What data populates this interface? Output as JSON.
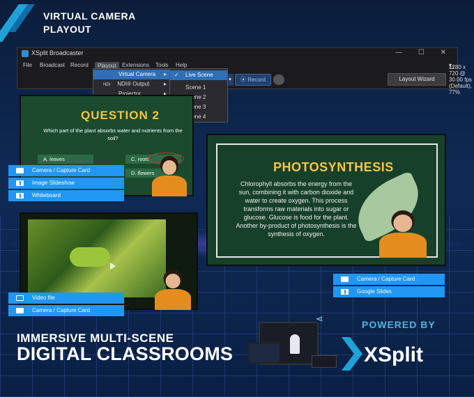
{
  "header": {
    "line1": "VIRTUAL CAMERA",
    "line2": "PLAYOUT"
  },
  "app": {
    "title": "XSplit Broadcaster",
    "window_buttons": "— ☐ ✕",
    "menu": [
      "File",
      "Broadcast",
      "Record",
      "Playout",
      "Extensions",
      "Tools",
      "Help"
    ],
    "resolution": "1280 x 720 @ 30.00 fps (Default), 77%",
    "record_label": "⦿ Record",
    "layout_wizard": "Layout Wizard"
  },
  "playout_menu": [
    {
      "label": "Virtual Camera",
      "arrow": "▸"
    },
    {
      "label": "NDI® Output",
      "prefix": "NDI",
      "arrow": "▸"
    },
    {
      "label": "Projector",
      "arrow": "▸"
    }
  ],
  "scene_menu": [
    {
      "label": "Live Scene",
      "checked": "✓"
    },
    {
      "label": "Scene 1"
    },
    {
      "label": "Scene 2"
    },
    {
      "label": "Scene 3"
    },
    {
      "label": "Scene 4"
    }
  ],
  "question": {
    "title": "QUESTION 2",
    "text": "Which part of the plant absorbs water and nutrients from the soil?",
    "answers": [
      "A. leaves",
      "C. roots",
      "D. flowers"
    ]
  },
  "sources_left": [
    "Camera / Capture Card",
    "Image Slideshow",
    "Whiteboard"
  ],
  "photosynthesis": {
    "title": "PHOTOSYNTHESIS",
    "body": "Chlorophyll absorbs the energy from the sun, combining it with carbon dioxide and water to create oxygen. This process transforms raw materials into sugar or glucose. Glucose is food for the plant. Another by-product of photosynthesis is the synthesis of oxygen."
  },
  "sources_right": [
    "Camera / Capture Card",
    "Google Slides"
  ],
  "sources_video": [
    "Video file",
    "Camera / Capture Card"
  ],
  "bottom": {
    "line1": "IMMERSIVE MULTI-SCENE",
    "line2": "DIGITAL CLASSROOMS",
    "powered": "POWERED BY",
    "brand": "XSplit"
  },
  "colors": {
    "accent": "#2196f3",
    "brand": "#1fa2d8",
    "title_gold": "#f5c542",
    "board_green": "#17402a"
  }
}
